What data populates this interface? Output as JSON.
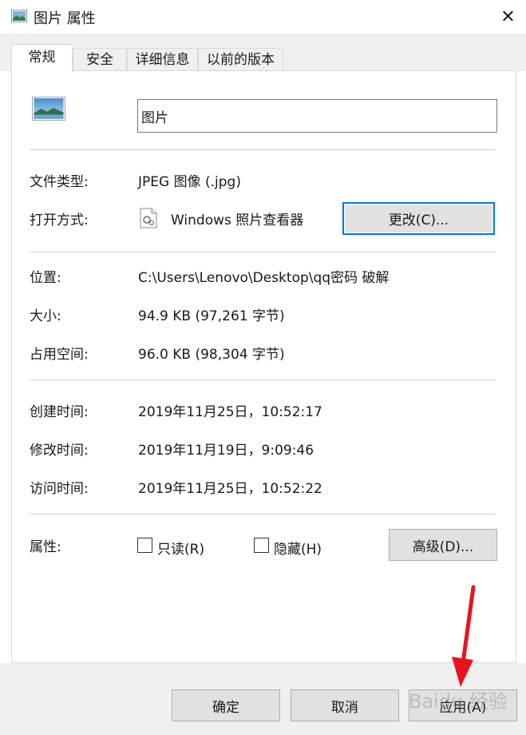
{
  "window": {
    "title": "图片 属性",
    "close_icon": "close-icon"
  },
  "tabs": [
    {
      "label": "常规",
      "active": true
    },
    {
      "label": "安全",
      "active": false
    },
    {
      "label": "详细信息",
      "active": false
    },
    {
      "label": "以前的版本",
      "active": false
    }
  ],
  "general": {
    "file_name": "图片",
    "type_label": "文件类型:",
    "type_value": "JPEG 图像 (.jpg)",
    "opens_with_label": "打开方式:",
    "opens_with_app": "Windows 照片查看器",
    "change_button": "更改(C)...",
    "location_label": "位置:",
    "location_value": "C:\\Users\\Lenovo\\Desktop\\qq密码 破解",
    "size_label": "大小:",
    "size_value": "94.9 KB (97,261 字节)",
    "disk_size_label": "占用空间:",
    "disk_size_value": "96.0 KB (98,304 字节)",
    "created_label": "创建时间:",
    "created_value": "2019年11月25日，10:52:17",
    "modified_label": "修改时间:",
    "modified_value": "2019年11月19日，9:09:46",
    "accessed_label": "访问时间:",
    "accessed_value": "2019年11月25日，10:52:22",
    "attributes_label": "属性:",
    "readonly_label": "只读(R)",
    "readonly_checked": false,
    "hidden_label": "隐藏(H)",
    "hidden_checked": false,
    "advanced_button": "高级(D)..."
  },
  "footer": {
    "ok_button": "确定",
    "cancel_button": "取消",
    "apply_button": "应用(A)"
  },
  "colors": {
    "focus_border": "#0078d7",
    "arrow": "#e8141c"
  },
  "watermark": "Baidu 经验"
}
